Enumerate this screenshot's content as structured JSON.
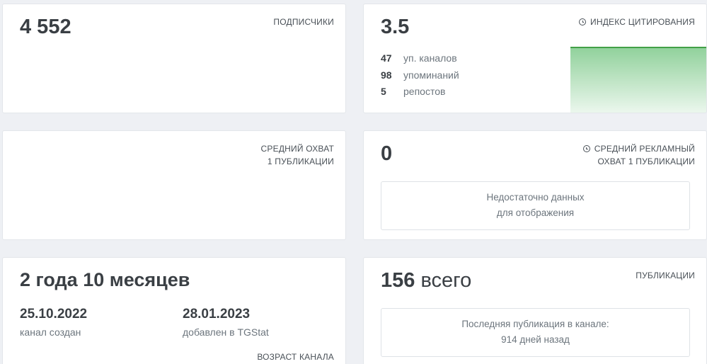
{
  "subscribers": {
    "value": "4 552",
    "label": "ПОДПИСЧИКИ"
  },
  "citation": {
    "value": "3.5",
    "label": "ИНДЕКС ЦИТИРОВАНИЯ",
    "icon": "clock-icon",
    "stats": [
      {
        "num": "47",
        "text": "уп. каналов"
      },
      {
        "num": "98",
        "text": "упоминаний"
      },
      {
        "num": "5",
        "text": "репостов"
      }
    ],
    "chart_color": "#4caf50"
  },
  "avg_reach": {
    "label_line1": "СРЕДНИЙ ОХВАТ",
    "label_line2": "1 ПУБЛИКАЦИИ"
  },
  "ad_reach": {
    "value": "0",
    "icon": "clock-icon",
    "label_line1": "СРЕДНИЙ РЕКЛАМНЫЙ",
    "label_line2": "ОХВАТ 1 ПУБЛИКАЦИИ",
    "message_line1": "Недостаточно данных",
    "message_line2": "для отображения"
  },
  "age": {
    "value": "2 года 10 месяцев",
    "created_date": "25.10.2022",
    "created_caption": "канал создан",
    "added_date": "28.01.2023",
    "added_caption": "добавлен в TGStat",
    "label": "ВОЗРАСТ КАНАЛА"
  },
  "publications": {
    "value": "156",
    "suffix": "всего",
    "label": "ПУБЛИКАЦИИ",
    "message_line1": "Последняя публикация в канале:",
    "message_line2": "914 дней назад"
  }
}
